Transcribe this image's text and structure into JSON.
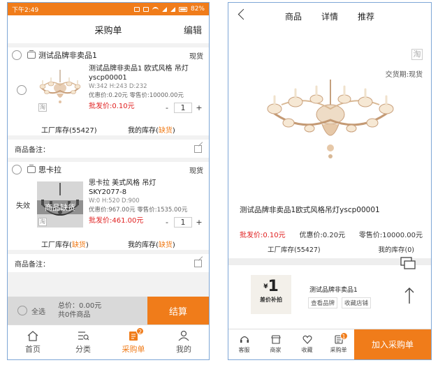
{
  "left": {
    "status": {
      "time": "下午2:49",
      "battery": "82%"
    },
    "header": {
      "title": "采购单",
      "edit": "编辑"
    },
    "cards": [
      {
        "shop": "测试品牌非卖品1",
        "stock_tag": "现货",
        "name": "测试品牌非卖品1 欧式风格 吊灯",
        "code": "yscp00001",
        "dims": "W:342 H:243 D:232",
        "prices": "优惠价:0.20元  零售价:10000.00元",
        "wholesale": "批发价:0.10元",
        "qty": "1",
        "factory_label": "工厂库存(55427)",
        "my_label": "我的库存(",
        "my_value": "缺货",
        "my_close": ")",
        "thumb_tag": "淘"
      },
      {
        "shop": "思卡拉",
        "stock_tag": "现货",
        "invalid": "失效",
        "name": "思卡拉 美式风格 吊灯",
        "code": "SKY2077-8",
        "dims": "W:0 H:520 D:900",
        "prices": "优惠价:967.00元 零售价:1535.00元",
        "wholesale": "批发价:461.00元",
        "qty": "1",
        "nostock": "商品缺货",
        "factory_label": "工厂库存(",
        "factory_value": "缺货",
        "factory_close": ")",
        "my_label": "我的库存(",
        "my_value": "缺货",
        "my_close": ")",
        "thumb_tag": "淘"
      }
    ],
    "remark_label": "商品备注：",
    "checkout": {
      "all": "全选",
      "total": "总价：0.00元",
      "count": "共0件商品",
      "settle": "结算"
    },
    "tabs": [
      {
        "label": "首页",
        "icon": "home-icon"
      },
      {
        "label": "分类",
        "icon": "category-icon"
      },
      {
        "label": "采购单",
        "icon": "order-icon",
        "badge": "2"
      },
      {
        "label": "我的",
        "icon": "user-icon"
      }
    ]
  },
  "right": {
    "tabs": [
      "商品",
      "详情",
      "推荐"
    ],
    "tao": "淘",
    "delivery": "交货期:现货",
    "title": "测试品牌非卖品1欧式风格吊灯yscp00001",
    "wholesale": "批发价:0.10元",
    "discount": "优惠价:0.20元",
    "retail": "零售价:10000.00元",
    "factory_stock": "工厂库存(55427)",
    "my_stock": "我的库存(0)",
    "store_badge_num": "1",
    "store_badge_yen": "¥",
    "store_badge_sub": "差价补拍",
    "store_name": "测试品牌非卖品1",
    "store_links": [
      "查看品牌",
      "收藏店铺"
    ],
    "bar": [
      {
        "label": "客服",
        "icon": "headset-icon"
      },
      {
        "label": "商家",
        "icon": "store-icon"
      },
      {
        "label": "收藏",
        "icon": "heart-icon"
      },
      {
        "label": "采购单",
        "icon": "order-icon",
        "badge": "1"
      }
    ],
    "add_cart": "加入采购单"
  },
  "colors": {
    "accent": "#f07c1a",
    "price_red": "#e02020",
    "frame": "#7ea6d6"
  }
}
